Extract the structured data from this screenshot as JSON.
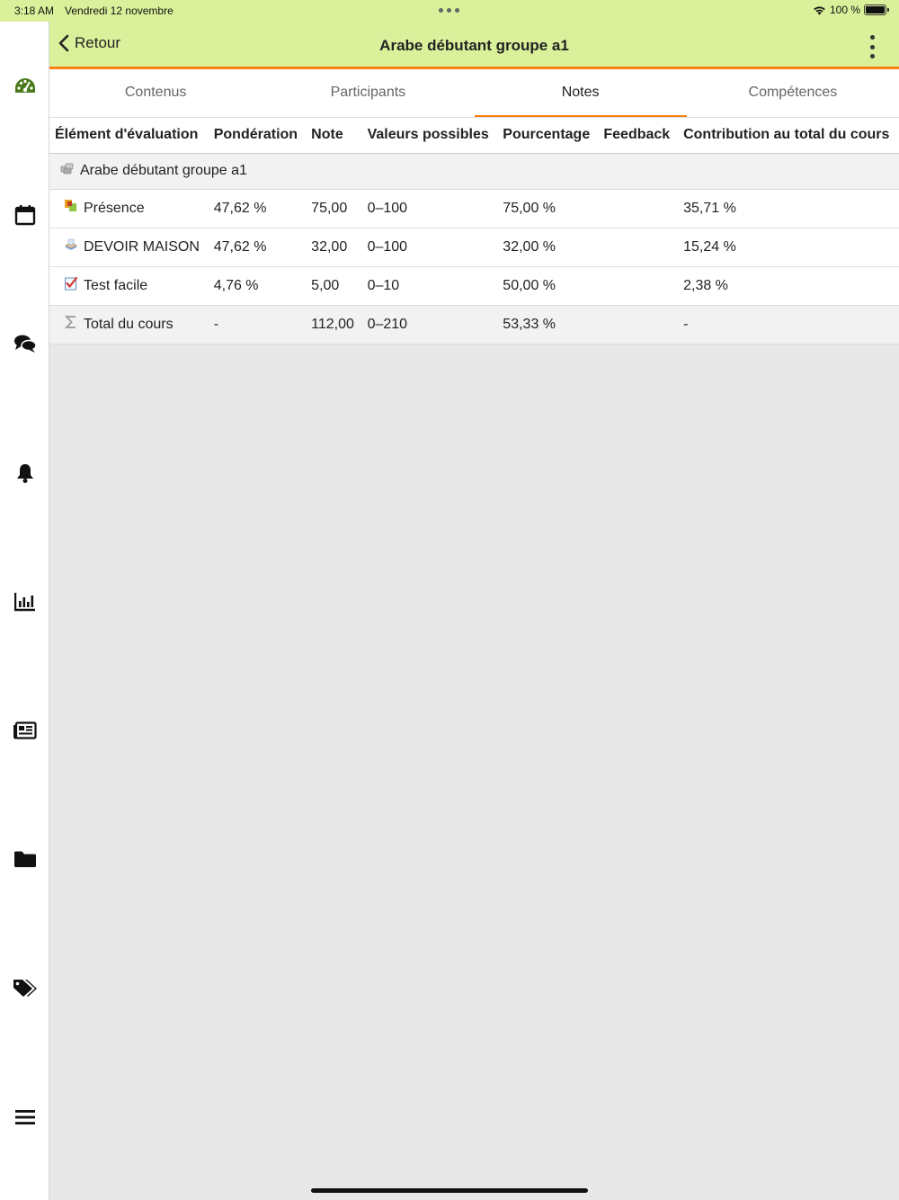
{
  "status_bar": {
    "time": "3:18 AM",
    "date": "Vendredi 12 novembre",
    "battery": "100 %"
  },
  "header": {
    "back_label": "Retour",
    "title": "Arabe débutant groupe a1"
  },
  "tabs": [
    {
      "label": "Contenus",
      "active": false
    },
    {
      "label": "Participants",
      "active": false
    },
    {
      "label": "Notes",
      "active": true
    },
    {
      "label": "Compétences",
      "active": false
    }
  ],
  "sidebar": {
    "icons": [
      "dashboard-icon",
      "calendar-icon",
      "messages-icon",
      "notifications-icon",
      "grades-icon",
      "news-icon",
      "files-icon",
      "tags-icon",
      "menu-icon"
    ]
  },
  "grades": {
    "columns": [
      "Élément d'évaluation",
      "Pondération",
      "Note",
      "Valeurs possibles",
      "Pourcentage",
      "Feedback",
      "Contribution au total du cours"
    ],
    "category": "Arabe débutant groupe a1",
    "rows": [
      {
        "icon": "attendance-icon",
        "item": "Présence",
        "weight": "47,62 %",
        "grade": "75,00",
        "range": "0–100",
        "percentage": "75,00 %",
        "feedback": "",
        "contribution": "35,71 %"
      },
      {
        "icon": "assignment-icon",
        "item": "DEVOIR MAISON",
        "weight": "47,62 %",
        "grade": "32,00",
        "range": "0–100",
        "percentage": "32,00 %",
        "feedback": "",
        "contribution": "15,24 %"
      },
      {
        "icon": "quiz-icon",
        "item": "Test facile",
        "weight": "4,76 %",
        "grade": "5,00",
        "range": "0–10",
        "percentage": "50,00 %",
        "feedback": "",
        "contribution": "2,38 %"
      }
    ],
    "total": {
      "icon": "sigma-icon",
      "item": "Total du cours",
      "weight": "-",
      "grade": "112,00",
      "range": "0–210",
      "percentage": "53,33 %",
      "feedback": "",
      "contribution": "-"
    }
  },
  "colors": {
    "header_bg": "#daf09a",
    "accent": "#f98012",
    "dashboard_icon": "#4a7a1c"
  }
}
